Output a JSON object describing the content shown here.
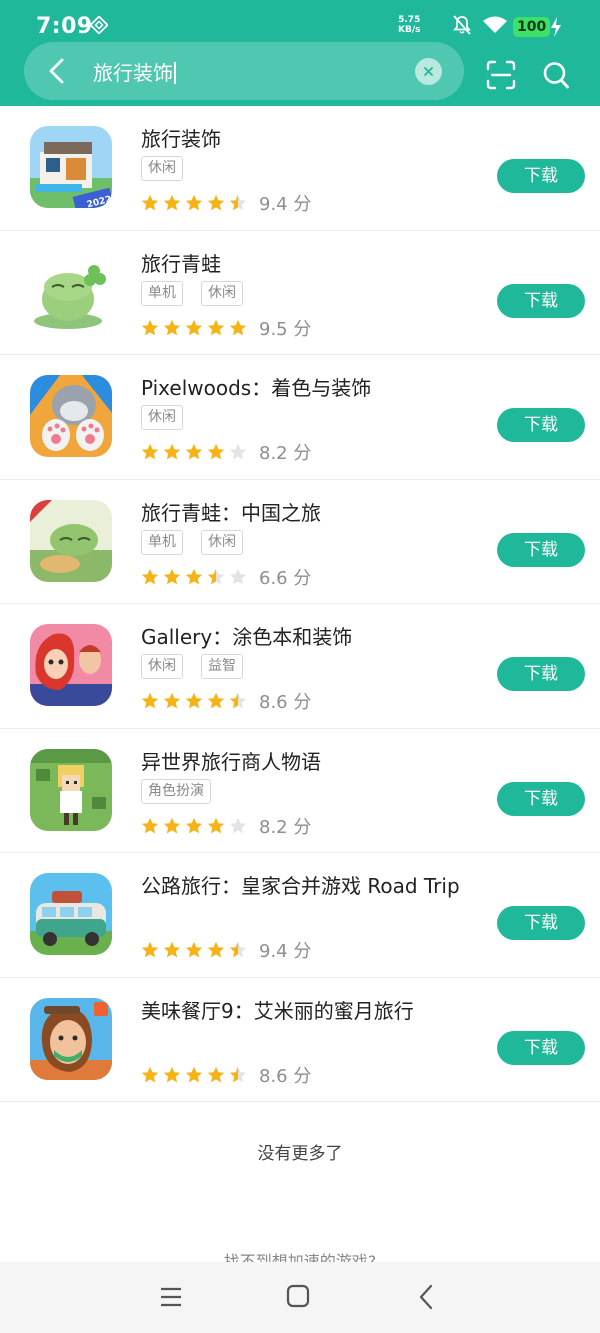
{
  "status_bar": {
    "time": "7:09",
    "net_speed_value": "5.75",
    "net_speed_unit": "KB/s",
    "battery": "100"
  },
  "search": {
    "query": "旅行装饰"
  },
  "apps": [
    {
      "name": "旅行装饰",
      "tags": [
        "休闲"
      ],
      "rating": 4.5,
      "score": "9.4 分",
      "button": "下载"
    },
    {
      "name": "旅行青蛙",
      "tags": [
        "单机",
        "休闲"
      ],
      "rating": 5,
      "score": "9.5 分",
      "button": "下载"
    },
    {
      "name": "Pixelwoods：着色与装饰",
      "tags": [
        "休闲"
      ],
      "rating": 4,
      "score": "8.2 分",
      "button": "下载"
    },
    {
      "name": "旅行青蛙：中国之旅",
      "tags": [
        "单机",
        "休闲"
      ],
      "rating": 3.5,
      "score": "6.6 分",
      "button": "下载"
    },
    {
      "name": "Gallery：涂色本和装饰",
      "tags": [
        "休闲",
        "益智"
      ],
      "rating": 4.5,
      "score": "8.6 分",
      "button": "下载"
    },
    {
      "name": "异世界旅行商人物语",
      "tags": [
        "角色扮演"
      ],
      "rating": 4,
      "score": "8.2 分",
      "button": "下载"
    },
    {
      "name": "公路旅行：皇家合并游戏 Road Trip",
      "tags": [],
      "rating": 4.5,
      "score": "9.4 分",
      "button": "下载"
    },
    {
      "name": "美味餐厅9：艾米丽的蜜月旅行",
      "tags": [],
      "rating": 4.5,
      "score": "8.6 分",
      "button": "下载"
    }
  ],
  "footer": {
    "no_more": "没有更多了",
    "cant_find": "找不到想加速的游戏?"
  },
  "colors": {
    "brand": "#1fb89a",
    "star": "#f5b316",
    "star_empty": "#e3e3e3"
  }
}
